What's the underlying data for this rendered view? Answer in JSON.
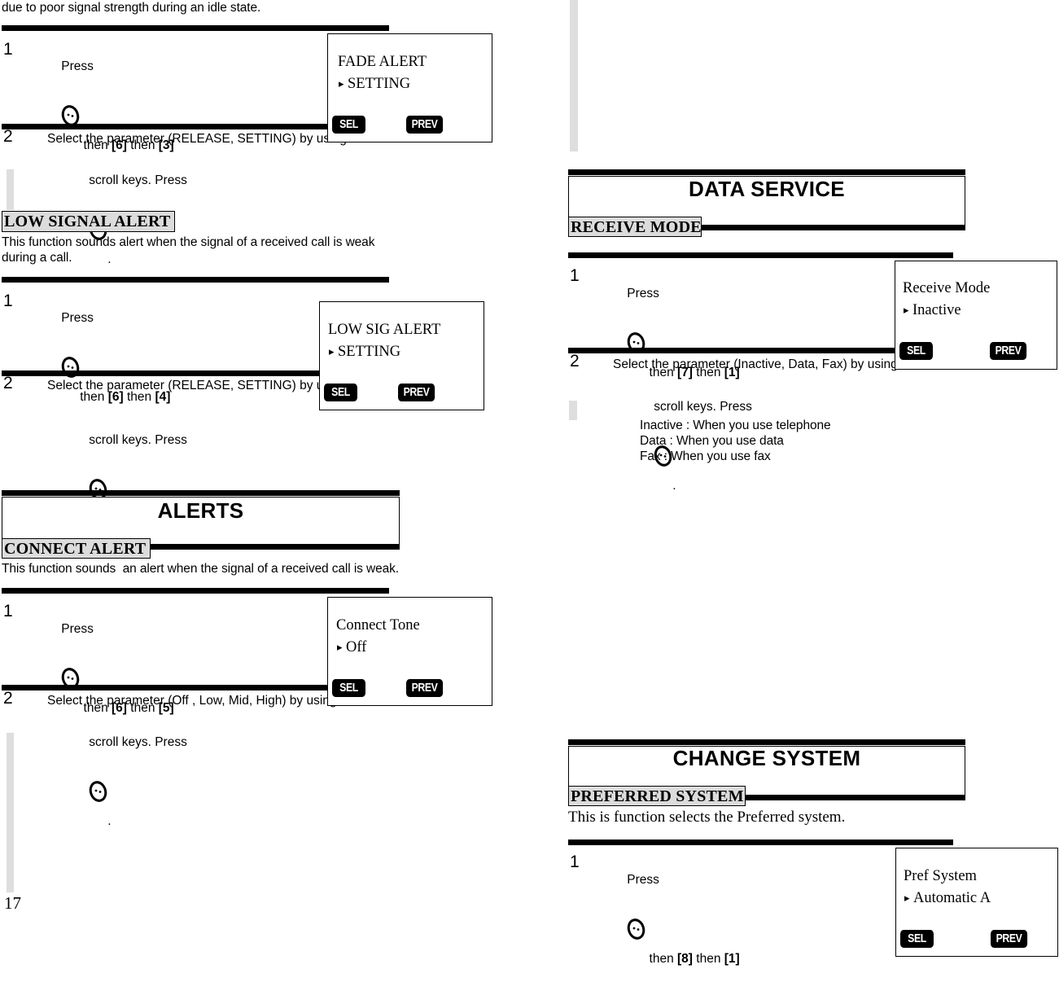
{
  "page": {
    "number": "17",
    "icon_name": "menu-oval-key-icon"
  },
  "left_column": {
    "intro_text": "due to poor signal strength during an idle state.",
    "fade_alert": {
      "steps": [
        {
          "num": "1",
          "text_before": "Press",
          "text_after": " then [6] then [3]",
          "keys": [
            "6",
            "3"
          ]
        },
        {
          "num": "2",
          "line1": "Select the parameter (RELEASE, SETTING) by using",
          "line2": "scroll keys. Press"
        }
      ],
      "lcd": {
        "title": "FADE ALERT",
        "value": "SETTING",
        "arrow": "▸",
        "softkey_left": "SEL",
        "softkey_right": "PREV"
      }
    },
    "low_signal_alert": {
      "heading": "LOW SIGNAL ALERT",
      "description_line1": "This function sounds alert when the signal of a received call is weak",
      "description_line2": "during a call.",
      "steps": [
        {
          "num": "1",
          "text_before": "Press",
          "text_after": "then [6] then [4]",
          "keys": [
            "6",
            "4"
          ]
        },
        {
          "num": "2",
          "line1": "Select the parameter (RELEASE, SETTING) by using",
          "line2": "scroll keys. Press"
        }
      ],
      "lcd": {
        "title": "LOW SIG ALERT",
        "value": "SETTING",
        "arrow": "▸",
        "softkey_left": "SEL",
        "softkey_right": "PREV"
      }
    },
    "alerts_section": {
      "title": "ALERTS",
      "sub_heading": "CONNECT ALERT",
      "description": "This function sounds  an alert when the signal of a received call is weak.",
      "steps": [
        {
          "num": "1",
          "text_before": "Press",
          "text_after": " then [6] then [5]",
          "keys": [
            "6",
            "5"
          ]
        },
        {
          "num": "2",
          "line1": "Select the parameter (Off , Low, Mid, High) by using",
          "line2": "scroll keys. Press"
        }
      ],
      "lcd": {
        "title": "Connect Tone",
        "value": "Off",
        "arrow": "▸",
        "softkey_left": "SEL",
        "softkey_right": "PREV"
      }
    }
  },
  "right_column": {
    "data_service_section": {
      "title": "DATA SERVICE",
      "sub_heading": "RECEIVE MODE",
      "steps": [
        {
          "num": "1",
          "text_before": "Press",
          "text_after": " then [7] then [1]",
          "keys": [
            "7",
            "1"
          ]
        },
        {
          "num": "2",
          "line1": "Select the parameter (Inactive, Data, Fax) by using",
          "line2": "scroll keys. Press"
        }
      ],
      "notes": [
        "Inactive : When you use telephone",
        "Data : When you use data",
        "Fax : When you use fax"
      ],
      "lcd": {
        "title": "Receive Mode",
        "value": "Inactive",
        "arrow": "▸",
        "softkey_left": "SEL",
        "softkey_right": "PREV"
      }
    },
    "change_system_section": {
      "title": "CHANGE SYSTEM",
      "sub_heading": "PREFERRED SYSTEM",
      "description": "This is function selects the Preferred system.",
      "steps": [
        {
          "num": "1",
          "text_before": "Press",
          "text_after": " then [8] then [1]",
          "keys": [
            "8",
            "1"
          ]
        }
      ],
      "lcd": {
        "title": "Pref System",
        "value": "Automatic A",
        "arrow": "▸",
        "softkey_left": "SEL",
        "softkey_right": "PREV"
      }
    }
  }
}
